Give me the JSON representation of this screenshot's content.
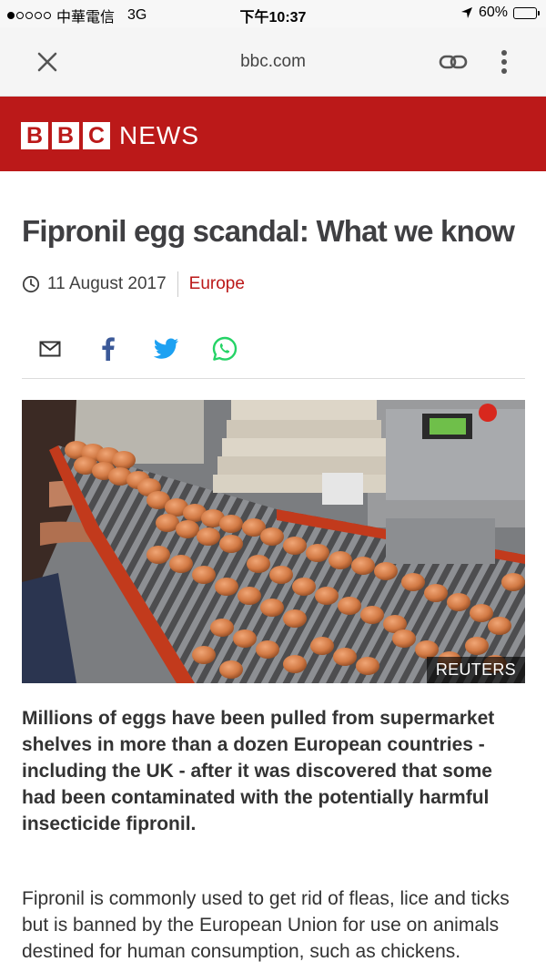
{
  "status_bar": {
    "carrier": "中華電信",
    "network": "3G",
    "time": "下午10:37",
    "battery": "60%",
    "battery_level": 0.6
  },
  "browser": {
    "url": "bbc.com"
  },
  "brand": {
    "letters": [
      "B",
      "B",
      "C"
    ],
    "news": "NEWS",
    "color": "#bb1919"
  },
  "article": {
    "headline": "Fipronil egg scandal: What we know",
    "date": "11 August 2017",
    "section": "Europe",
    "image_credit": "REUTERS",
    "intro": "Millions of eggs have been pulled from supermarket shelves in more than a dozen European countries - including the UK - after it was discovered that some had been contaminated with the potentially harmful insecticide fipronil.",
    "body": "Fipronil is commonly used to get rid of fleas, lice and ticks but is banned by the European Union for use on animals destined for human consumption, such as chickens."
  },
  "share": [
    "email-icon",
    "facebook-icon",
    "twitter-icon",
    "whatsapp-icon"
  ],
  "colors": {
    "facebook": "#3b5998",
    "twitter": "#1da1f2",
    "whatsapp": "#25d366"
  }
}
